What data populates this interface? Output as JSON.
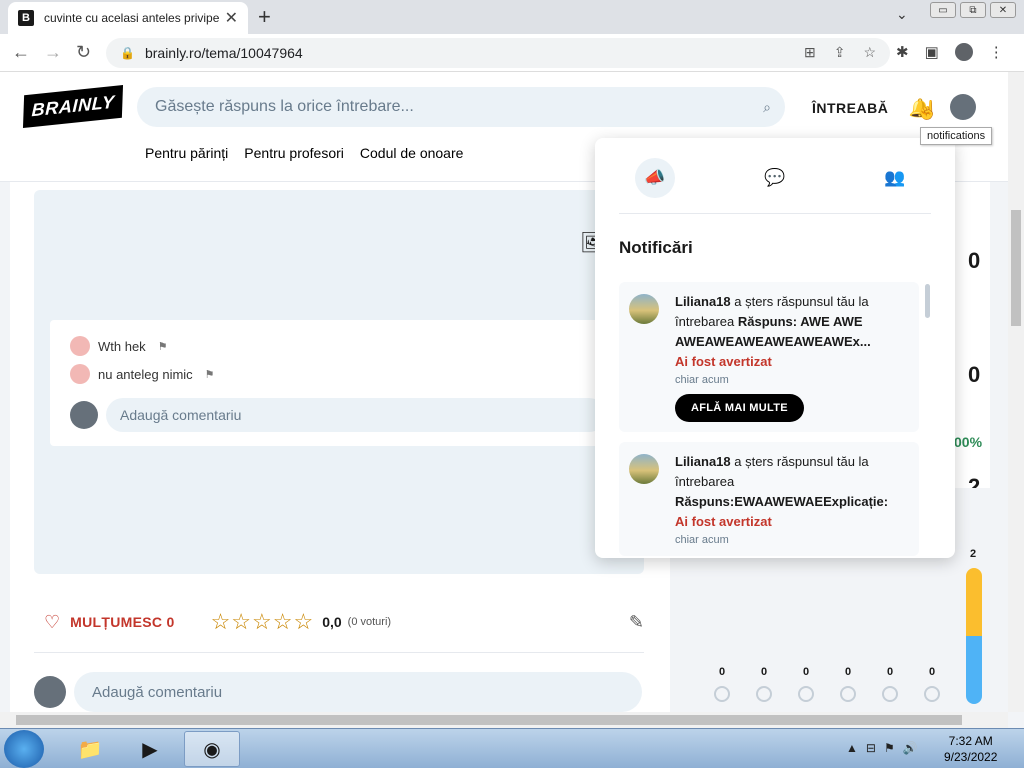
{
  "browser": {
    "tab_title": "cuvinte cu acelasi anteles privipe",
    "tab_favicon": "B",
    "tab_close": "✕",
    "new_tab": "+",
    "chevron": "⌄",
    "url": "brainly.ro/tema/10047964",
    "window_buttons": [
      "▭",
      "⧉",
      "✕"
    ]
  },
  "header": {
    "logo": "BRAINLY",
    "search_placeholder": "Găsește răspuns la orice întrebare...",
    "ask_label": "ÎNTREABĂ",
    "tooltip": "notifications",
    "subnav": [
      "Pentru părinți",
      "Pentru profesori",
      "Codul de onoare"
    ]
  },
  "answer": {
    "comments": [
      {
        "text": "Wth hek"
      },
      {
        "text": "nu anteleg nimic"
      }
    ],
    "comment_placeholder": "Adaugă comentariu",
    "thanks_label": "MULȚUMESC 0",
    "rating": "0,0",
    "votes": "(0 voturi)",
    "stars": "☆☆☆☆☆",
    "bottom_comment_placeholder": "Adaugă comentariu"
  },
  "right_panel": {
    "numbers": [
      "0",
      "0",
      "2"
    ],
    "percent": "00%",
    "bar_label": "2",
    "dot_values": [
      "0",
      "0",
      "0",
      "0",
      "0",
      "0"
    ]
  },
  "notifications": {
    "title": "Notificări",
    "items": [
      {
        "user": "Liliana18",
        "text": " a șters răspunsul tău la întrebarea ",
        "question": "Răspuns:  AWE AWE AWEAWEAWEAWEAWEAWEx...",
        "warning": "Ai fost avertizat",
        "time": "chiar acum",
        "button": "AFLĂ MAI MULTE"
      },
      {
        "user": "Liliana18",
        "text": " a șters răspunsul tău la întrebarea ",
        "question": "Răspuns:EWAAWEWAEExplicație:",
        "warning": "Ai fost avertizat",
        "time": "chiar acum"
      }
    ]
  },
  "taskbar": {
    "time": "7:32 AM",
    "date": "9/23/2022"
  },
  "colors": {
    "brand_red": "#c3362b",
    "search_bg": "#ebf2f7",
    "star": "#c98600",
    "bar_yellow": "#fbbe2e",
    "bar_blue": "#4fb3f6"
  }
}
